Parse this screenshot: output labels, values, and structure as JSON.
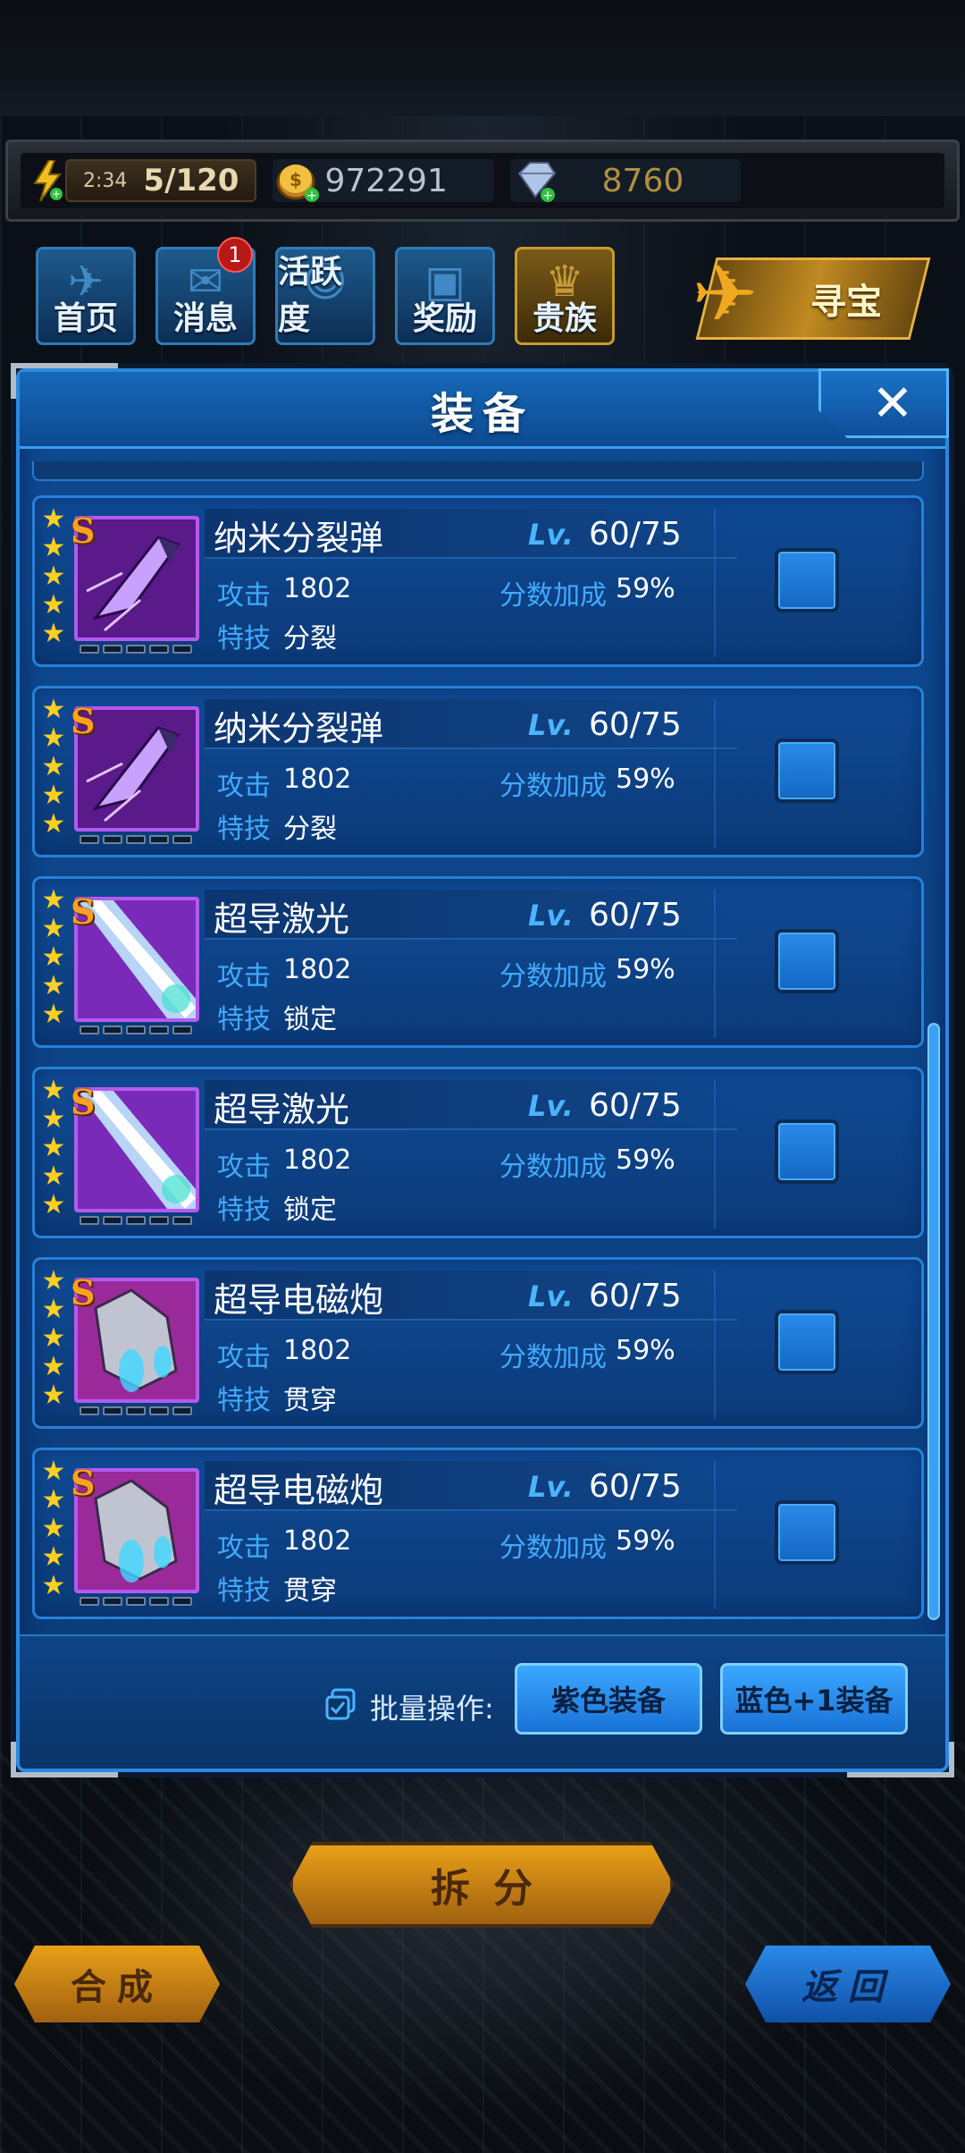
{
  "resources": {
    "energy_timer": "2:34",
    "energy_count": "5/120",
    "coins": "972291",
    "gems": "8760"
  },
  "nav": [
    {
      "label": "首页",
      "icon": "jet-icon"
    },
    {
      "label": "消息",
      "icon": "mail-icon",
      "badge": "1"
    },
    {
      "label": "活跃度",
      "icon": "smile-icon"
    },
    {
      "label": "奖励",
      "icon": "gift-icon"
    },
    {
      "label": "贵族",
      "icon": "noble-icon"
    }
  ],
  "treasure_label": "寻宝",
  "panel": {
    "title": "装备",
    "close_glyph": "✕"
  },
  "items": [
    {
      "name": "纳米分裂弹",
      "lv_tag": "Lv.",
      "level": "60/75",
      "atk_label": "攻击",
      "atk": "1802",
      "bonus_label": "分数加成",
      "bonus": "59%",
      "skill_label": "特技",
      "skill": "分裂",
      "rank": "S",
      "weapon": "nano-split-missile-icon"
    },
    {
      "name": "纳米分裂弹",
      "lv_tag": "Lv.",
      "level": "60/75",
      "atk_label": "攻击",
      "atk": "1802",
      "bonus_label": "分数加成",
      "bonus": "59%",
      "skill_label": "特技",
      "skill": "分裂",
      "rank": "S",
      "weapon": "nano-split-missile-icon"
    },
    {
      "name": "超导激光",
      "lv_tag": "Lv.",
      "level": "60/75",
      "atk_label": "攻击",
      "atk": "1802",
      "bonus_label": "分数加成",
      "bonus": "59%",
      "skill_label": "特技",
      "skill": "锁定",
      "rank": "S",
      "weapon": "laser-icon"
    },
    {
      "name": "超导激光",
      "lv_tag": "Lv.",
      "level": "60/75",
      "atk_label": "攻击",
      "atk": "1802",
      "bonus_label": "分数加成",
      "bonus": "59%",
      "skill_label": "特技",
      "skill": "锁定",
      "rank": "S",
      "weapon": "laser-icon"
    },
    {
      "name": "超导电磁炮",
      "lv_tag": "Lv.",
      "level": "60/75",
      "atk_label": "攻击",
      "atk": "1802",
      "bonus_label": "分数加成",
      "bonus": "59%",
      "skill_label": "特技",
      "skill": "贯穿",
      "rank": "S",
      "weapon": "railgun-icon"
    },
    {
      "name": "超导电磁炮",
      "lv_tag": "Lv.",
      "level": "60/75",
      "atk_label": "攻击",
      "atk": "1802",
      "bonus_label": "分数加成",
      "bonus": "59%",
      "skill_label": "特技",
      "skill": "贯穿",
      "rank": "S",
      "weapon": "railgun-icon"
    }
  ],
  "batch": {
    "label": "批量操作:",
    "purple_btn": "紫色装备",
    "blue_btn": "蓝色+1装备"
  },
  "actions": {
    "split": "拆分",
    "merge": "合成",
    "back": "返回"
  },
  "colors": {
    "panel_bg": "#0b3b7a",
    "accent_blue": "#40aaff",
    "gold": "#e8a018",
    "star": "#ffd020",
    "rarity_purple": "#b45af0"
  }
}
